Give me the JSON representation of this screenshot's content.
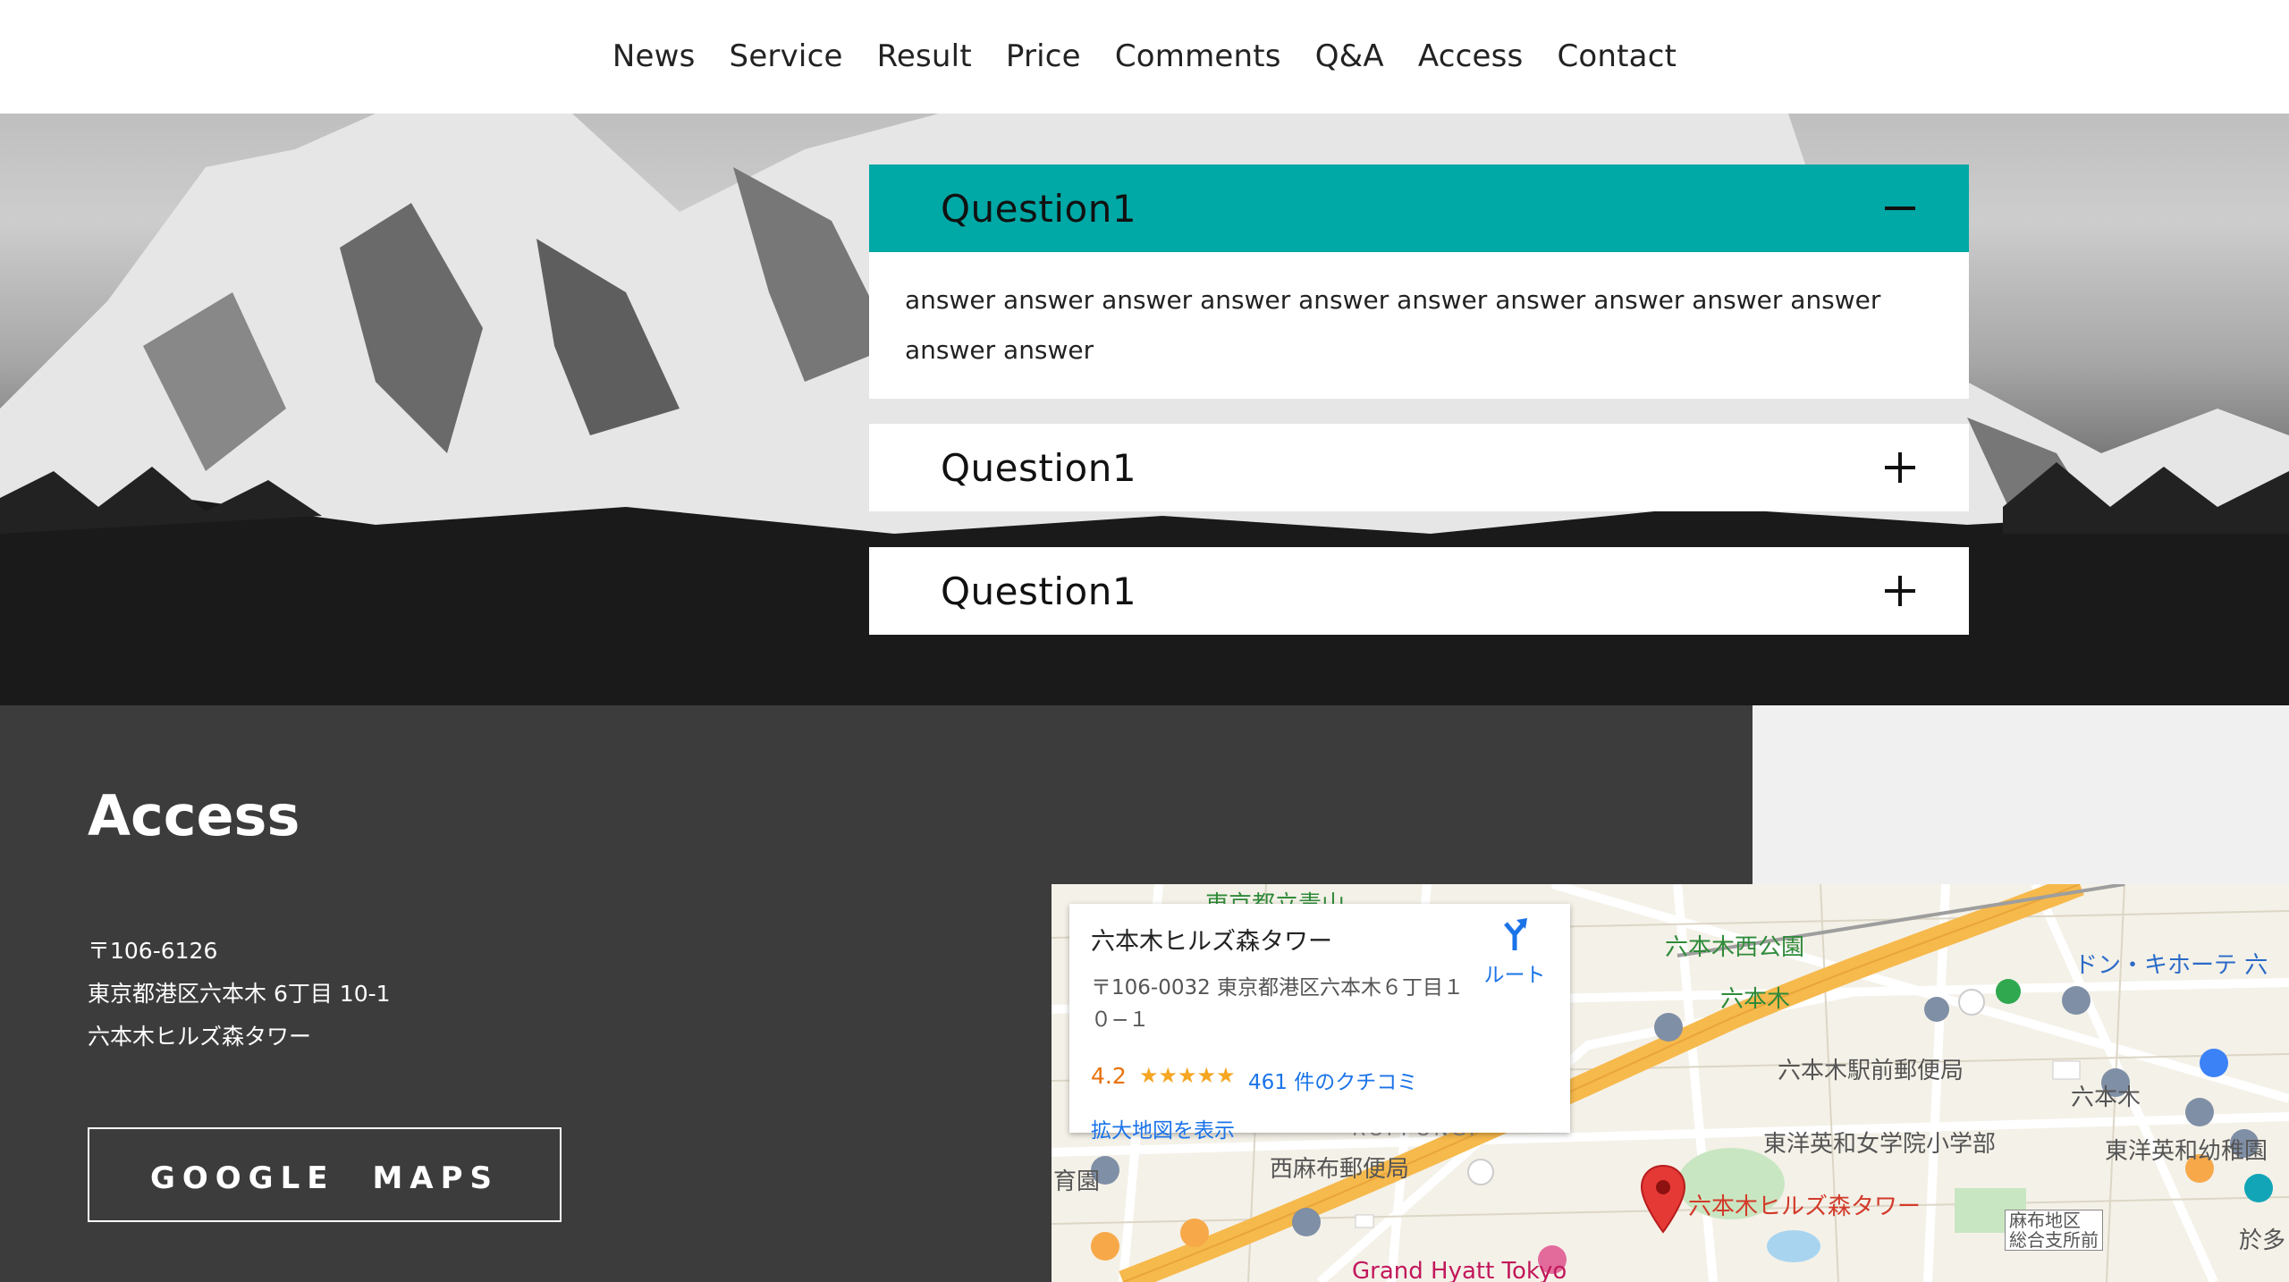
{
  "nav": [
    "News",
    "Service",
    "Result",
    "Price",
    "Comments",
    "Q&A",
    "Access",
    "Contact"
  ],
  "faq": [
    {
      "question": "Question1",
      "answer": "answer answer answer answer answer answer answer answer answer answer answer answer",
      "open": true
    },
    {
      "question": "Question1",
      "open": false
    },
    {
      "question": "Question1",
      "open": false
    }
  ],
  "access": {
    "title": "Access",
    "postal": "〒106-6126",
    "address": "東京都港区六本木 6丁目 10-1",
    "building": "六本木ヒルズ森タワー",
    "button": "GOOGLE　MAPS"
  },
  "map": {
    "place_name": "六本木ヒルズ森タワー",
    "place_address": "〒106-0032 東京都港区六本木６丁目１０−１",
    "route_label": "ルート",
    "rating": "4.2",
    "stars": "★★★★★",
    "reviews": "461 件のクチコミ",
    "larger_map": "拡大地図を表示",
    "labels": {
      "l1": "東京都立青山",
      "l2": "六本木西公園",
      "l3": "六本木",
      "l4": "ドン・キホーテ 六",
      "l5": "六本木駅前郵便局",
      "l6": "六本木",
      "l7": "東洋英和女学院小学部",
      "l8": "東洋英和幼稚園",
      "l9": "西麻布郵便局",
      "l10": "六本木ヒルズ森タワー",
      "l11": "Grand Hyatt Tokyo",
      "l12": "麻布地区\n総合支所前",
      "l13": "於多",
      "l14": "育園",
      "l15": "ROPPONGI"
    }
  },
  "colors": {
    "accent": "#00a8a6",
    "dark": "#3c3c3c",
    "pin": "#e53935",
    "road": "#f6b94c"
  }
}
